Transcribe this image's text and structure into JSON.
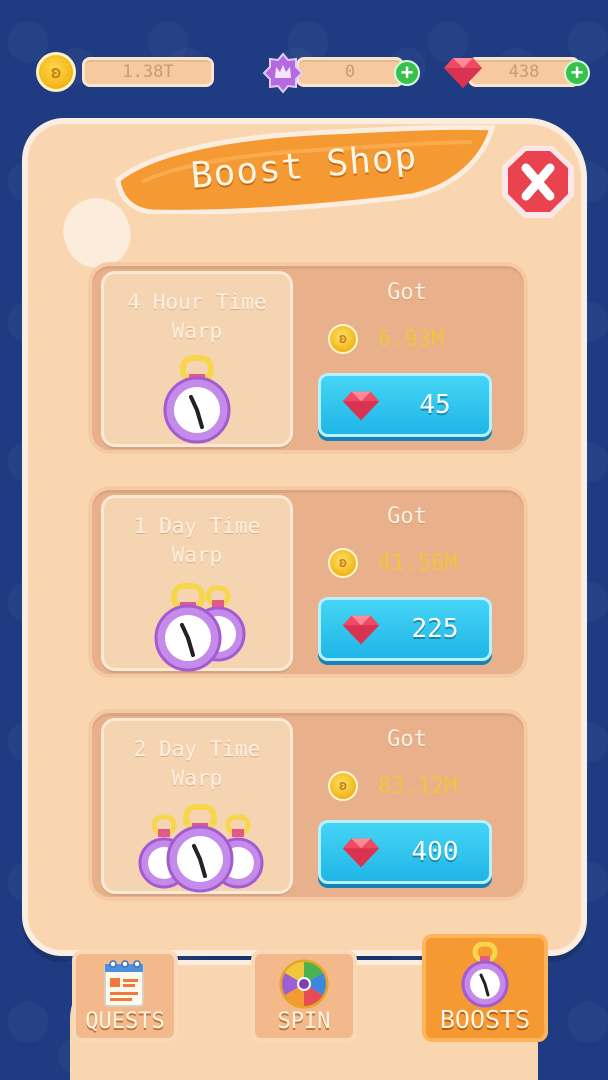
{
  "currencies": {
    "coins": {
      "icon": "butterfly-coin-icon",
      "value": "1.38T"
    },
    "crowns": {
      "icon": "crown-badge-icon",
      "value": "0"
    },
    "gems": {
      "icon": "ruby-gem-icon",
      "value": "438"
    }
  },
  "shop": {
    "title": "Boost Shop",
    "close_icon": "close-x-icon",
    "items": [
      {
        "name": "4 Hour Time Warp",
        "got_label": "Got",
        "reward": "6.93M",
        "price": "45",
        "timers": 1
      },
      {
        "name": "1 Day Time Warp",
        "got_label": "Got",
        "reward": "41.56M",
        "price": "225",
        "timers": 2
      },
      {
        "name": "2 Day Time Warp",
        "got_label": "Got",
        "reward": "83.12M",
        "price": "400",
        "timers": 3
      }
    ]
  },
  "nav": {
    "tabs": [
      {
        "label": "QUESTS",
        "icon": "quest-list-icon"
      },
      {
        "label": "SPIN",
        "icon": "spin-wheel-icon"
      },
      {
        "label": "BOOSTS",
        "icon": "stopwatch-icon",
        "active": true
      }
    ]
  },
  "colors": {
    "background": "#1f3c82",
    "panel": "#f9d6b0",
    "banner": "#f59a33",
    "buy_button": "#2cc3ee",
    "close_button": "#e8434f",
    "reward_text": "#f3c340"
  }
}
